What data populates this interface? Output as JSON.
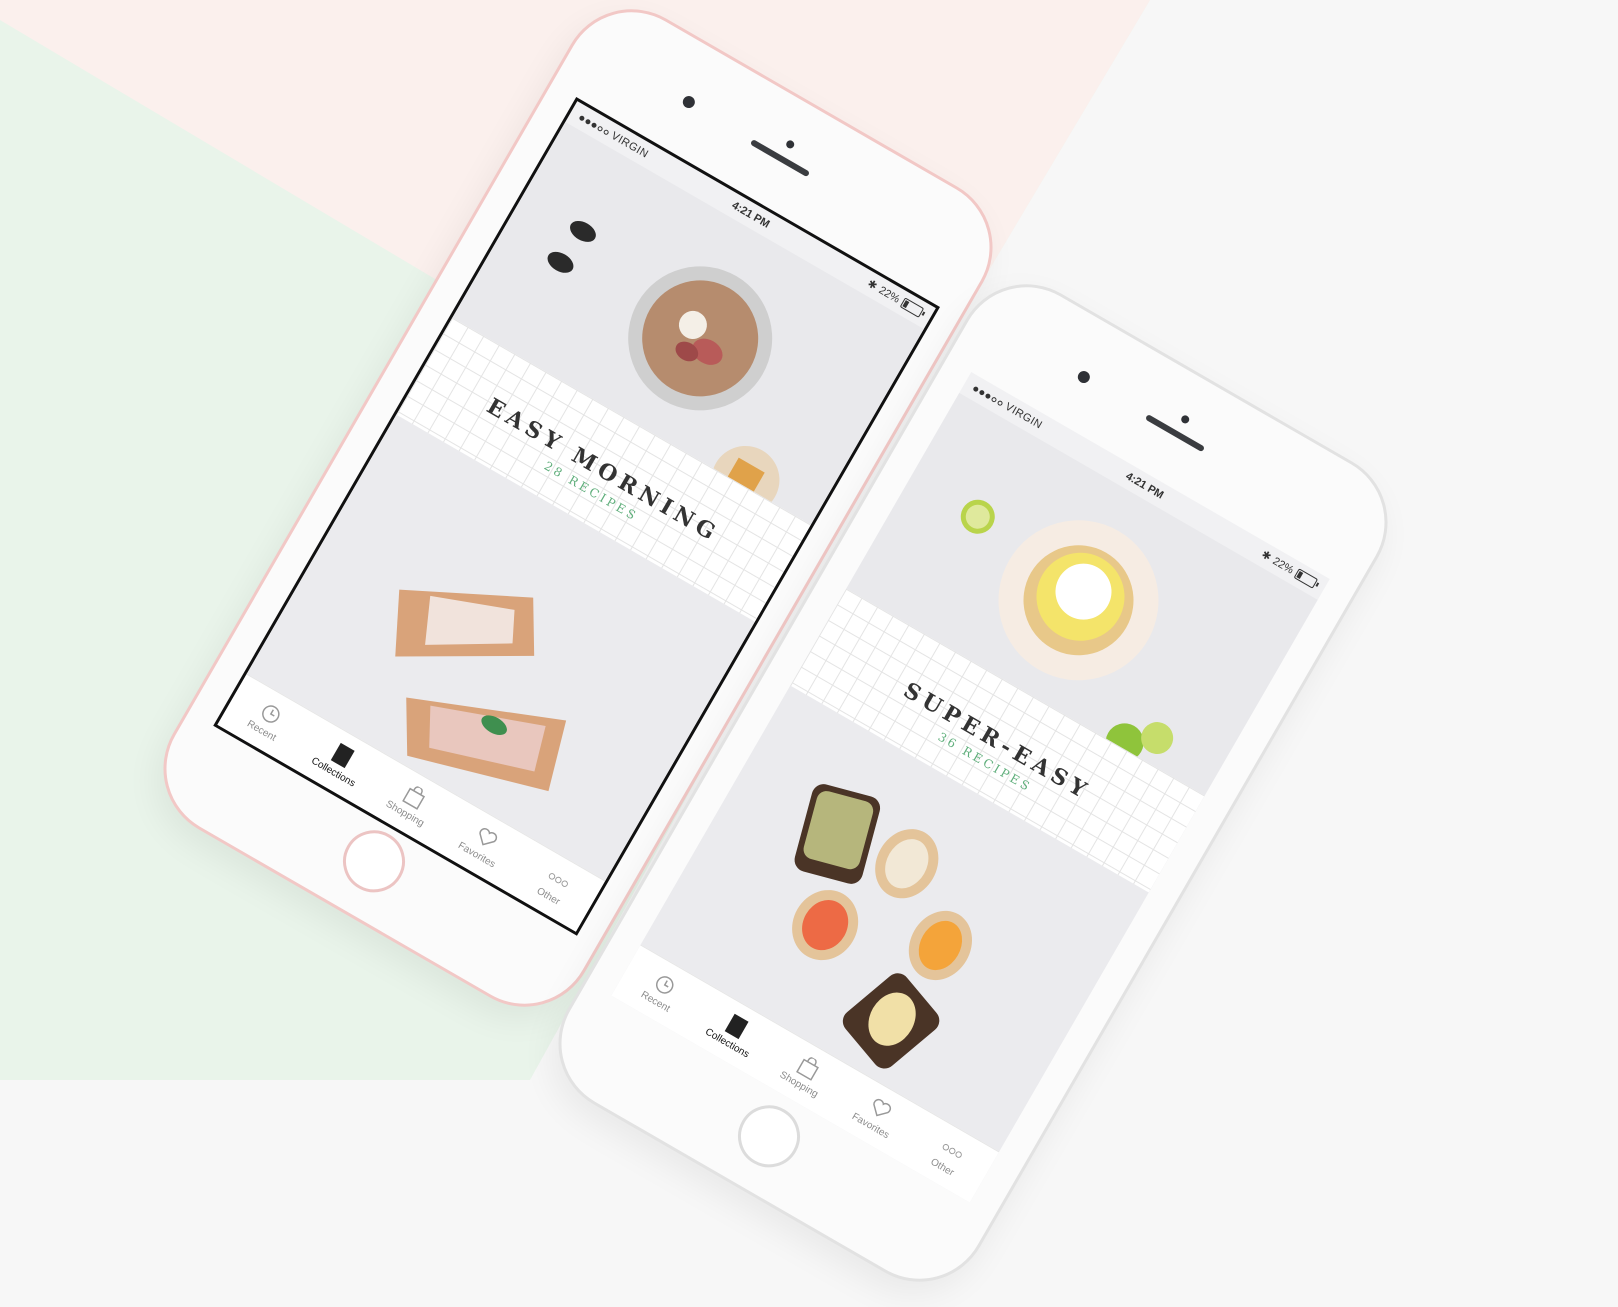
{
  "background": {
    "colors": {
      "green": "#e9f4ea",
      "pink": "#fbf0ed",
      "light_gray": "#f7f7f7"
    }
  },
  "phones": [
    {
      "finish": "rose-gold",
      "status_bar": {
        "carrier": "VIRGIN",
        "time": "4:21 PM",
        "battery_text": "22%",
        "battery_level": 0.22
      },
      "collection": {
        "title": "EASY MORNING",
        "count_label": "28 RECIPES"
      },
      "images": {
        "featured": "granola-bowl-with-figs-and-honeycomb",
        "secondary": "prosciutto-pizza-slices"
      },
      "tabs": [
        {
          "label": "Recent",
          "icon": "clock-icon",
          "active": false
        },
        {
          "label": "Collections",
          "icon": "book-icon",
          "active": true
        },
        {
          "label": "Shopping",
          "icon": "shopping-bag-icon",
          "active": false
        },
        {
          "label": "Favorites",
          "icon": "heart-icon",
          "active": false
        },
        {
          "label": "Other",
          "icon": "more-dots-icon",
          "active": false
        }
      ]
    },
    {
      "finish": "silver",
      "status_bar": {
        "carrier": "VIRGIN",
        "time": "4:21 PM",
        "battery_text": "22%",
        "battery_level": 0.22
      },
      "collection": {
        "title": "SUPER-EASY",
        "count_label": "36 RECIPES"
      },
      "images": {
        "featured": "lime-tart-on-plate",
        "secondary": "assorted-toasts"
      },
      "tabs": [
        {
          "label": "Recent",
          "icon": "clock-icon",
          "active": false
        },
        {
          "label": "Collections",
          "icon": "book-icon",
          "active": true
        },
        {
          "label": "Shopping",
          "icon": "shopping-bag-icon",
          "active": false
        },
        {
          "label": "Favorites",
          "icon": "heart-icon",
          "active": false
        },
        {
          "label": "Other",
          "icon": "more-dots-icon",
          "active": false
        }
      ]
    }
  ]
}
